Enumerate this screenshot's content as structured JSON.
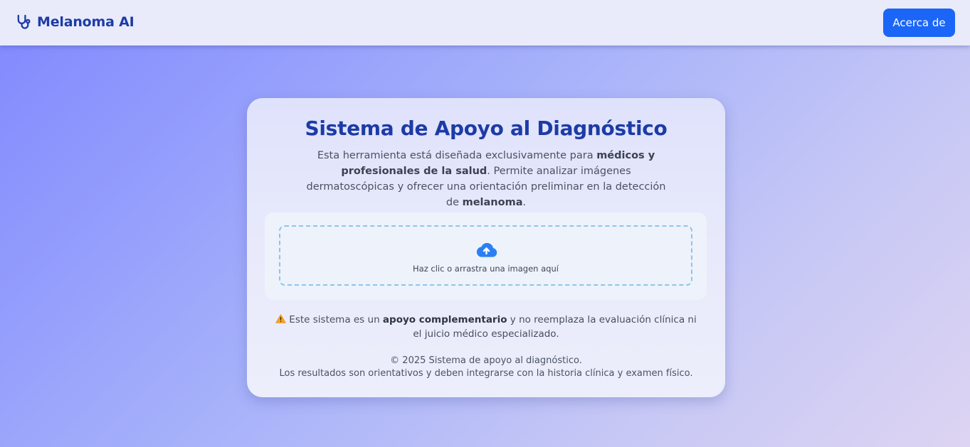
{
  "navbar": {
    "brand_icon": "stethoscope-icon",
    "brand_name": "Melanoma AI",
    "about_label": "Acerca de"
  },
  "card": {
    "title": "Sistema de Apoyo al Diagnóstico",
    "intro": {
      "part1": "Esta herramienta está diseñada exclusivamente para ",
      "bold1": "médicos y profesionales de la salud",
      "part2": ". Permite analizar imágenes dermatoscópicas y ofrecer una orientación preliminar en la detección de ",
      "bold2": "melanoma",
      "part3": "."
    },
    "upload": {
      "icon": "cloud-upload-icon",
      "label": "Haz clic o arrastra una imagen aquí"
    },
    "warning": {
      "icon": "warning-icon",
      "part1": "Este sistema es un ",
      "bold": "apoyo complementario",
      "part2": " y no reemplaza la evaluación clínica ni el juicio médico especializado."
    },
    "footer": {
      "line1": "© 2025 Sistema de apoyo al diagnóstico.",
      "line2": "Los resultados son orientativos y deben integrarse con la historia clínica y examen físico."
    }
  },
  "colors": {
    "brand": "#1d3ba7",
    "primary_button": "#1b66f6",
    "upload_icon": "#2b7ff3",
    "dropzone_border": "#8ec4ec"
  }
}
